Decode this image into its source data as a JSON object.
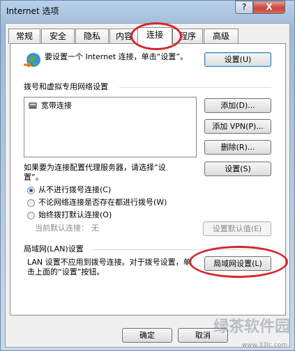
{
  "window": {
    "title": "Internet 选项",
    "help_label": "?",
    "close_label": "X"
  },
  "tabs": [
    {
      "label": "常规"
    },
    {
      "label": "安全"
    },
    {
      "label": "隐私"
    },
    {
      "label": "内容"
    },
    {
      "label": "连接"
    },
    {
      "label": "程序"
    },
    {
      "label": "高级"
    }
  ],
  "active_tab": "连接",
  "setup": {
    "text": "要设置一个 Internet 连接，单击“设置”。",
    "button": "设置(U)"
  },
  "dialup": {
    "heading": "拨号和虚拟专用网络设置",
    "connections": [
      {
        "name": "宽带连接"
      }
    ],
    "add_button": "添加(D)...",
    "add_vpn_button": "添加 VPN(P)...",
    "remove_button": "删除(R)...",
    "proxy_text": "如果要为连接配置代理服务器，请选择“设置”。",
    "settings_button": "设置(S)",
    "options": [
      {
        "label": "从不进行拨号连接(C)",
        "selected": true
      },
      {
        "label": "不论网络连接是否存在都进行拨号(W)",
        "selected": false
      },
      {
        "label": "始终拨打默认连接(O)",
        "selected": false
      }
    ],
    "current_default_label": "当前默认连接：",
    "current_default_value": "无",
    "set_default_button": "设置默认值(E)"
  },
  "lan": {
    "heading": "局域网(LAN)设置",
    "text": "LAN 设置不应用到拨号连接。对于拨号设置，单击上面的“设置”按钮。",
    "button": "局域网设置(L)"
  },
  "footer": {
    "ok": "确定",
    "cancel": "取消"
  },
  "watermark": {
    "text": "绿茶软件园",
    "url": "www.33lc.com"
  },
  "colors": {
    "highlight_ring": "#d4262b"
  }
}
